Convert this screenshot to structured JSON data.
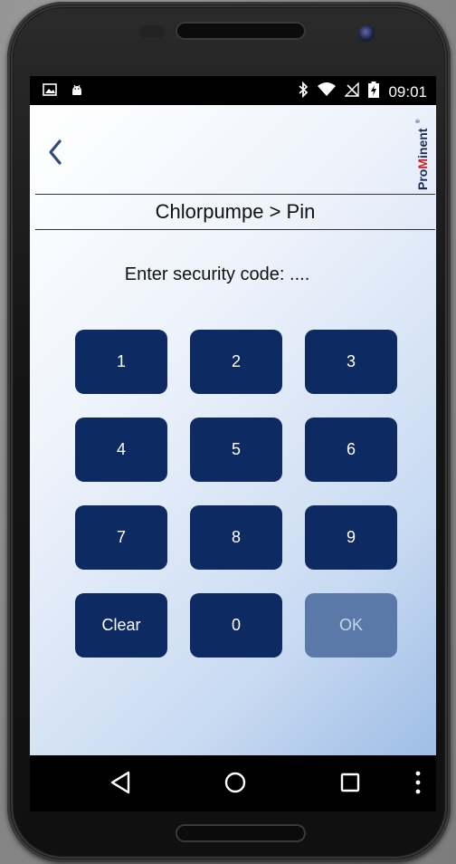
{
  "statusbar": {
    "time": "09:01",
    "left_icons": [
      "image-icon",
      "android-icon"
    ],
    "right_icons": [
      "bluetooth-icon",
      "wifi-icon",
      "no-signal-icon",
      "battery-charging-icon"
    ]
  },
  "header": {
    "title": "Chlorpumpe > Pin",
    "logo_text": "ProMinent",
    "logo_mark": "®"
  },
  "pin": {
    "prompt": "Enter security code: ...."
  },
  "keypad": {
    "keys": [
      {
        "label": "1",
        "enabled": true
      },
      {
        "label": "2",
        "enabled": true
      },
      {
        "label": "3",
        "enabled": true
      },
      {
        "label": "4",
        "enabled": true
      },
      {
        "label": "5",
        "enabled": true
      },
      {
        "label": "6",
        "enabled": true
      },
      {
        "label": "7",
        "enabled": true
      },
      {
        "label": "8",
        "enabled": true
      },
      {
        "label": "9",
        "enabled": true
      },
      {
        "label": "Clear",
        "enabled": true
      },
      {
        "label": "0",
        "enabled": true
      },
      {
        "label": "OK",
        "enabled": false
      }
    ]
  },
  "navbar": {
    "items": [
      "back-triangle-icon",
      "home-circle-icon",
      "recents-square-icon",
      "overflow-menu-icon"
    ]
  },
  "colors": {
    "key_bg": "#0d2a63",
    "key_disabled_bg": "#5a79a8",
    "logo_red": "#d0242b",
    "logo_navy": "#1d2a5e"
  }
}
